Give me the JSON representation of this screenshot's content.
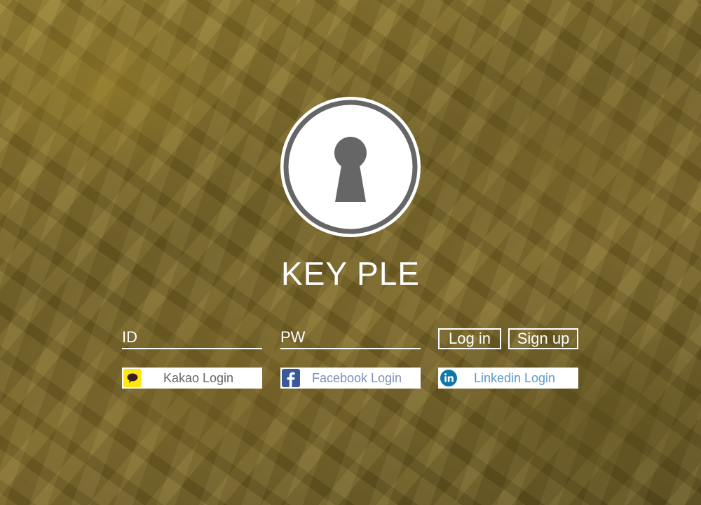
{
  "brand": {
    "name": "KEY PLE"
  },
  "form": {
    "id_placeholder": "ID",
    "pw_placeholder": "PW",
    "login_label": "Log in",
    "signup_label": "Sign up"
  },
  "social": [
    {
      "label": "Kakao Login",
      "icon": "kakao-talk-icon",
      "icon_color": "#FFE812",
      "text_color": "#666666"
    },
    {
      "label": "Facebook Login",
      "icon": "facebook-icon",
      "icon_color": "#3B5998",
      "text_color": "#7F8FB5"
    },
    {
      "label": "Linkedin Login",
      "icon": "linkedin-icon",
      "icon_color": "#0E76A8",
      "text_color": "#5B9AC8"
    }
  ],
  "colors": {
    "logo_gray": "#666666",
    "background": "#6E5D28",
    "foreground": "#FFFFFF"
  }
}
